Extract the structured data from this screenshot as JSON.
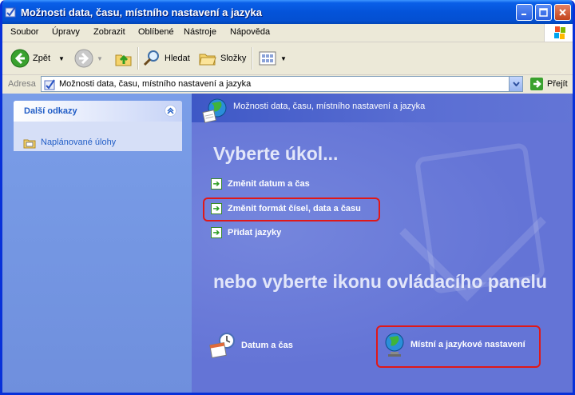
{
  "window": {
    "title": "Možnosti data, času, místního nastavení a jazyka"
  },
  "menu": [
    "Soubor",
    "Úpravy",
    "Zobrazit",
    "Oblíbené",
    "Nástroje",
    "Nápověda"
  ],
  "toolbar": {
    "back_label": "Zpět",
    "search_label": "Hledat",
    "folders_label": "Složky"
  },
  "address": {
    "label": "Adresa",
    "value": "Možnosti data, času, místního nastavení a jazyka",
    "go_label": "Přejít"
  },
  "sidebar": {
    "panel_title": "Další odkazy",
    "links": [
      {
        "label": "Naplánované úlohy",
        "icon": "scheduled-tasks-icon"
      }
    ]
  },
  "main": {
    "header_title": "Možnosti data, času, místního nastavení a jazyka",
    "pick_task_heading": "Vyberte úkol...",
    "tasks": [
      {
        "label": "Změnit datum a čas"
      },
      {
        "label": "Změnit formát čísel, data a času"
      },
      {
        "label": "Přidat jazyky"
      }
    ],
    "pick_icon_heading": "nebo vyberte ikonu ovládacího panelu",
    "icons": [
      {
        "label": "Datum a čas",
        "icon": "date-time-icon"
      },
      {
        "label": "Místní a jazykové nastavení",
        "icon": "globe-icon"
      }
    ]
  },
  "colors": {
    "title_bar": "#0453d9",
    "content_bg": "#6375d6",
    "sidebar_bg": "#7a9ee8",
    "highlight": "#e01818"
  }
}
